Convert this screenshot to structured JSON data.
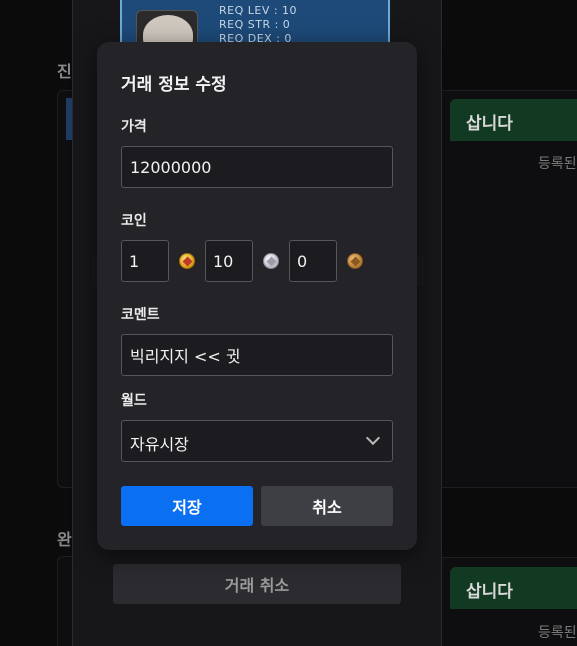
{
  "background": {
    "section_top_label": "진",
    "section_bottom_label": "완",
    "buy_header_top": "삽니다",
    "buy_header_bottom": "삽니다",
    "empty_text_top": "등록된",
    "empty_text_bottom": "등록된"
  },
  "item_card": {
    "stats": [
      "REQ LEV : 10",
      "REQ STR : 0",
      "REQ DEX : 0"
    ],
    "icon": "hat-icon"
  },
  "cancel_trade_label": "거래 취소",
  "dialog": {
    "title": "거래 정보 수정",
    "price": {
      "label": "가격",
      "value": "12000000"
    },
    "coin": {
      "label": "코인",
      "gold": {
        "value": "1",
        "icon": "gold-maple-coin-icon"
      },
      "silver": {
        "value": "10",
        "icon": "silver-maple-coin-icon"
      },
      "bronze": {
        "value": "0",
        "icon": "bronze-maple-coin-icon"
      }
    },
    "comment": {
      "label": "코멘트",
      "value": "빅리지지 << 귓"
    },
    "world": {
      "label": "월드",
      "selected": "자유시장"
    },
    "save_label": "저장",
    "cancel_label": "취소"
  },
  "colors": {
    "accent": "#0a6ff0",
    "dialog_bg": "#242428",
    "buy_header": "#123a23"
  }
}
